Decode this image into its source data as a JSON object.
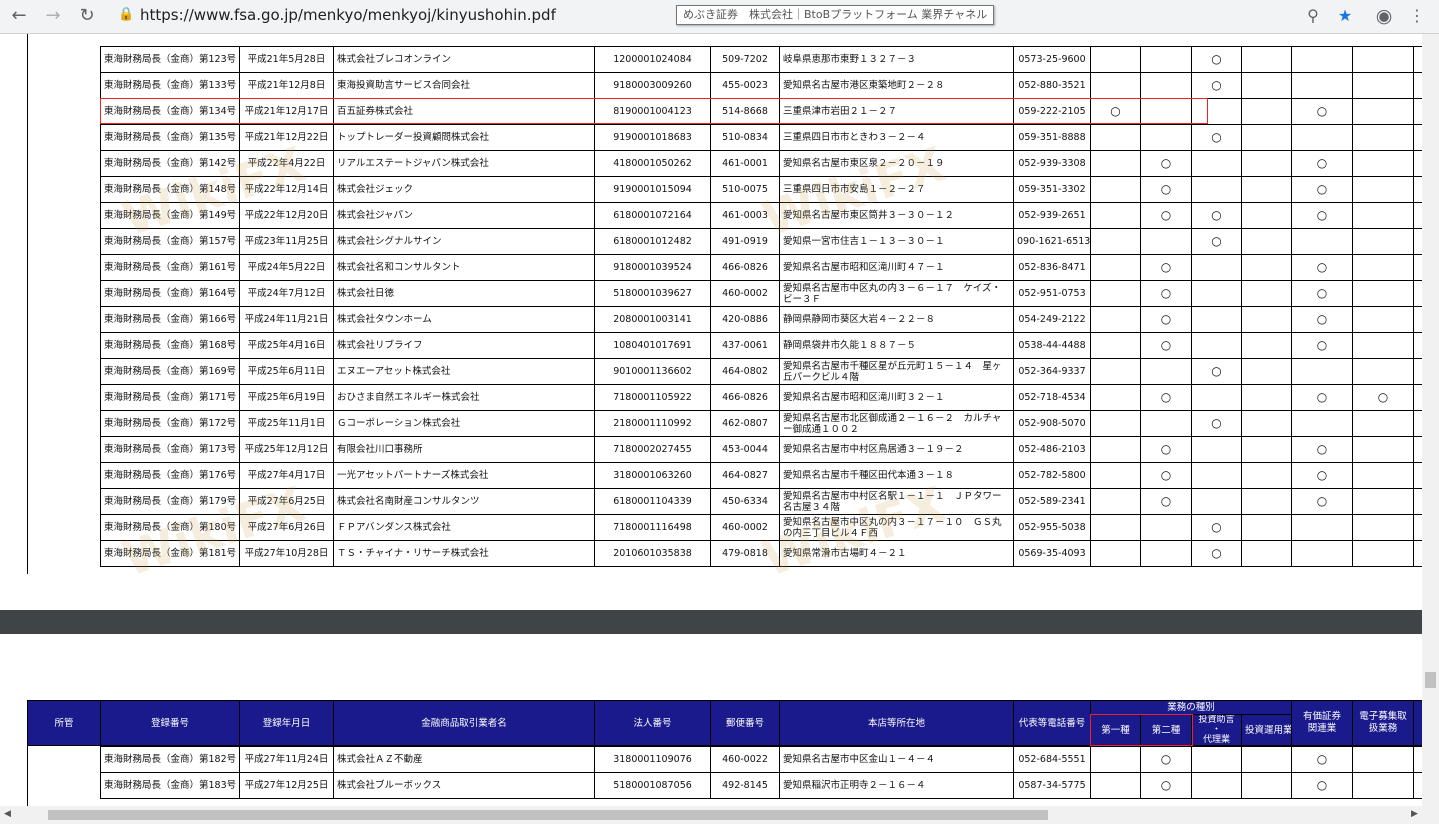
{
  "browser": {
    "url": "https://www.fsa.go.jp/menkyo/menkyoj/kinyushohin.pdf",
    "tooltip": "めぶき証券　株式会社｜BtoBプラットフォーム 業界チャネル"
  },
  "watermark": "WikiFX",
  "mark": "○",
  "rows": [
    {
      "auth": "東海財務局長（金商）第123号",
      "date": "平成21年5月28日",
      "name": "株式会社ブレコオンライン",
      "corp": "1200001024084",
      "zip": "509-7202",
      "addr": "岐阜県恵那市東野１３２７－３",
      "tel": "0573-25-9600",
      "m": [
        0,
        0,
        1,
        0,
        0,
        0,
        0
      ]
    },
    {
      "auth": "東海財務局長（金商）第133号",
      "date": "平成21年12月8日",
      "name": "東海投資助言サービス合同会社",
      "corp": "9180003009260",
      "zip": "455-0023",
      "addr": "愛知県名古屋市港区東築地町２－２８",
      "tel": "052-880-3521",
      "m": [
        0,
        0,
        1,
        0,
        0,
        0,
        0
      ]
    },
    {
      "auth": "東海財務局長（金商）第134号",
      "date": "平成21年12月17日",
      "name": "百五証券株式会社",
      "corp": "8190001004123",
      "zip": "514-8668",
      "addr": "三重県津市岩田２１－２７",
      "tel": "059-222-2105",
      "m": [
        1,
        0,
        0,
        0,
        1,
        0,
        0
      ]
    },
    {
      "auth": "東海財務局長（金商）第135号",
      "date": "平成21年12月22日",
      "name": "トップトレーダー投資顧問株式会社",
      "corp": "9190001018683",
      "zip": "510-0834",
      "addr": "三重県四日市市ときわ３－２－４",
      "tel": "059-351-8888",
      "m": [
        0,
        0,
        1,
        0,
        0,
        0,
        0
      ]
    },
    {
      "auth": "東海財務局長（金商）第142号",
      "date": "平成22年4月22日",
      "name": "リアルエステートジャパン株式会社",
      "corp": "4180001050262",
      "zip": "461-0001",
      "addr": "愛知県名古屋市東区泉２－２０－１９",
      "tel": "052-939-3308",
      "m": [
        0,
        1,
        0,
        0,
        1,
        0,
        0
      ]
    },
    {
      "auth": "東海財務局長（金商）第148号",
      "date": "平成22年12月14日",
      "name": "株式会社ジェック",
      "corp": "9190001015094",
      "zip": "510-0075",
      "addr": "三重県四日市市安島１－２－２７",
      "tel": "059-351-3302",
      "m": [
        0,
        1,
        0,
        0,
        1,
        0,
        0
      ]
    },
    {
      "auth": "東海財務局長（金商）第149号",
      "date": "平成22年12月20日",
      "name": "株式会社ジャパン",
      "corp": "6180001072164",
      "zip": "461-0003",
      "addr": "愛知県名古屋市東区筒井３－３０－１２",
      "tel": "052-939-2651",
      "m": [
        0,
        1,
        1,
        0,
        1,
        0,
        0
      ]
    },
    {
      "auth": "東海財務局長（金商）第157号",
      "date": "平成23年11月25日",
      "name": "株式会社シグナルサイン",
      "corp": "6180001012482",
      "zip": "491-0919",
      "addr": "愛知県一宮市住吉１－１３－３０－１",
      "tel": "090-1621-6513",
      "m": [
        0,
        0,
        1,
        0,
        0,
        0,
        0
      ]
    },
    {
      "auth": "東海財務局長（金商）第161号",
      "date": "平成24年5月22日",
      "name": "株式会社名和コンサルタント",
      "corp": "9180001039524",
      "zip": "466-0826",
      "addr": "愛知県名古屋市昭和区滝川町４７－１",
      "tel": "052-836-8471",
      "m": [
        0,
        1,
        0,
        0,
        1,
        0,
        0
      ]
    },
    {
      "auth": "東海財務局長（金商）第164号",
      "date": "平成24年7月12日",
      "name": "株式会社日徳",
      "corp": "5180001039627",
      "zip": "460-0002",
      "addr": "愛知県名古屋市中区丸の内３－６－１７　ケイズ・ビー３Ｆ",
      "tel": "052-951-0753",
      "m": [
        0,
        1,
        0,
        0,
        1,
        0,
        0
      ]
    },
    {
      "auth": "東海財務局長（金商）第166号",
      "date": "平成24年11月21日",
      "name": "株式会社タウンホーム",
      "corp": "2080001003141",
      "zip": "420-0886",
      "addr": "静岡県静岡市葵区大岩４－２２－８",
      "tel": "054-249-2122",
      "m": [
        0,
        1,
        0,
        0,
        1,
        0,
        0
      ]
    },
    {
      "auth": "東海財務局長（金商）第168号",
      "date": "平成25年4月16日",
      "name": "株式会社リブライフ",
      "corp": "1080401017691",
      "zip": "437-0061",
      "addr": "静岡県袋井市久能１８８７－５",
      "tel": "0538-44-4488",
      "m": [
        0,
        1,
        0,
        0,
        1,
        0,
        0
      ]
    },
    {
      "auth": "東海財務局長（金商）第169号",
      "date": "平成25年6月11日",
      "name": "エヌエーアセット株式会社",
      "corp": "9010001136602",
      "zip": "464-0802",
      "addr": "愛知県名古屋市千種区星が丘元町１５－１４　星ヶ丘パークビル４階",
      "tel": "052-364-9337",
      "m": [
        0,
        0,
        1,
        0,
        0,
        0,
        0
      ]
    },
    {
      "auth": "東海財務局長（金商）第171号",
      "date": "平成25年6月19日",
      "name": "おひさま自然エネルギー株式会社",
      "corp": "7180001105922",
      "zip": "466-0826",
      "addr": "愛知県名古屋市昭和区滝川町３２－１",
      "tel": "052-718-4534",
      "m": [
        0,
        1,
        0,
        0,
        1,
        1,
        0
      ]
    },
    {
      "auth": "東海財務局長（金商）第172号",
      "date": "平成25年11月1日",
      "name": "Ｇコーポレーション株式会社",
      "corp": "2180001110992",
      "zip": "462-0807",
      "addr": "愛知県名古屋市北区御成通２－１６－２　カルチャー御成通１００２",
      "tel": "052-908-5070",
      "m": [
        0,
        0,
        1,
        0,
        0,
        0,
        0
      ]
    },
    {
      "auth": "東海財務局長（金商）第173号",
      "date": "平成25年12月12日",
      "name": "有限会社川口事務所",
      "corp": "7180002027455",
      "zip": "453-0044",
      "addr": "愛知県名古屋市中村区鳥居通３－１９－２",
      "tel": "052-486-2103",
      "m": [
        0,
        1,
        0,
        0,
        1,
        0,
        0
      ]
    },
    {
      "auth": "東海財務局長（金商）第176号",
      "date": "平成27年4月17日",
      "name": "一光アセットパートナーズ株式会社",
      "corp": "3180001063260",
      "zip": "464-0827",
      "addr": "愛知県名古屋市千種区田代本通３－１８",
      "tel": "052-782-5800",
      "m": [
        0,
        1,
        0,
        0,
        1,
        0,
        0
      ]
    },
    {
      "auth": "東海財務局長（金商）第179号",
      "date": "平成27年6月25日",
      "name": "株式会社名南財産コンサルタンツ",
      "corp": "6180001104339",
      "zip": "450-6334",
      "addr": "愛知県名古屋市中村区名駅１－１－１　ＪＰタワー名古屋３４階",
      "tel": "052-589-2341",
      "m": [
        0,
        1,
        0,
        0,
        1,
        0,
        0
      ]
    },
    {
      "auth": "東海財務局長（金商）第180号",
      "date": "平成27年6月26日",
      "name": "ＦＰアバンダンス株式会社",
      "corp": "7180001116498",
      "zip": "460-0002",
      "addr": "愛知県名古屋市中区丸の内３－１７－１０　ＧＳ丸の内三丁目ビル４Ｆ西",
      "tel": "052-955-5038",
      "m": [
        0,
        0,
        1,
        0,
        0,
        0,
        0
      ]
    },
    {
      "auth": "東海財務局長（金商）第181号",
      "date": "平成27年10月28日",
      "name": "ＴＳ・チャイナ・リサーチ株式会社",
      "corp": "2010601035838",
      "zip": "479-0818",
      "addr": "愛知県常滑市古場町４－２１",
      "tel": "0569-35-4093",
      "m": [
        0,
        0,
        1,
        0,
        0,
        0,
        0
      ]
    }
  ],
  "header": {
    "jurisdiction": "所管",
    "reg_no": "登録番号",
    "reg_date": "登録年月日",
    "name": "金融商品取引業者名",
    "corp_no": "法人番号",
    "zip": "郵便番号",
    "address": "本店等所在地",
    "tel": "代表等電話番号",
    "business_type": "業務の種別",
    "type1": "第一種",
    "type2": "第二種",
    "advisory_a": "投資助言",
    "advisory_b": "・",
    "advisory_c": "代理業",
    "management": "投資運用業",
    "securities_a": "有価証券",
    "securities_b": "関連業",
    "electronic_a": "電子募集取",
    "electronic_b": "扱業務"
  },
  "rows2": [
    {
      "auth": "東海財務局長（金商）第182号",
      "date": "平成27年11月24日",
      "name": "株式会社ＡＺ不動産",
      "corp": "3180001109076",
      "zip": "460-0022",
      "addr": "愛知県名古屋市中区金山１－４－４",
      "tel": "052-684-5551",
      "m": [
        0,
        1,
        0,
        0,
        1,
        0,
        0
      ]
    },
    {
      "auth": "東海財務局長（金商）第183号",
      "date": "平成27年12月25日",
      "name": "株式会社ブルーボックス",
      "corp": "5180001087056",
      "zip": "492-8145",
      "addr": "愛知県稲沢市正明寺２－１６－４",
      "tel": "0587-34-5775",
      "m": [
        0,
        1,
        0,
        0,
        1,
        0,
        0
      ]
    }
  ]
}
